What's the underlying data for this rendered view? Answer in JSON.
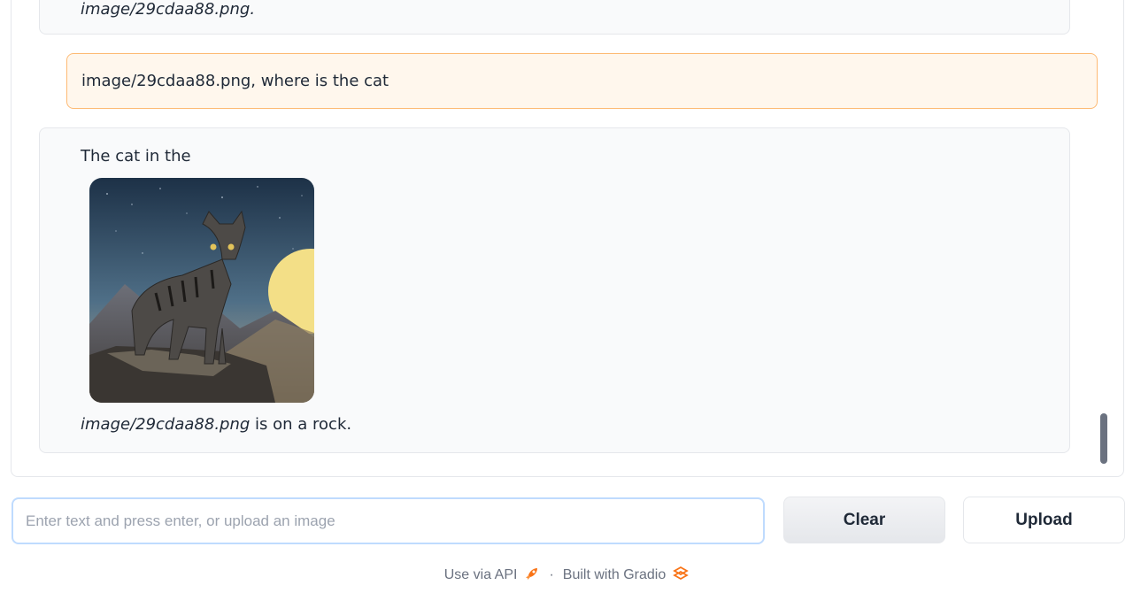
{
  "chat": {
    "prev_bot_tail": "image/29cdaa88.png",
    "prev_bot_tail_suffix": ".",
    "user_message": "image/29cdaa88.png, where is the cat",
    "bot_intro": "The cat in the",
    "bot_image_name": "image/29cdaa88.png",
    "bot_outro": " is on a rock."
  },
  "input": {
    "placeholder": "Enter text and press enter, or upload an image",
    "value": ""
  },
  "buttons": {
    "clear_label": "Clear",
    "upload_label": "Upload"
  },
  "footer": {
    "api_link": "Use via API",
    "separator": "·",
    "built_with": "Built with Gradio"
  },
  "icons": {
    "api": "rocket-icon",
    "gradio": "gradio-logo-icon"
  },
  "colors": {
    "user_bubble_bg": "#fff7ed",
    "user_bubble_border": "#fdba74",
    "bot_bubble_bg": "#f9fafb",
    "accent": "#f97316"
  }
}
